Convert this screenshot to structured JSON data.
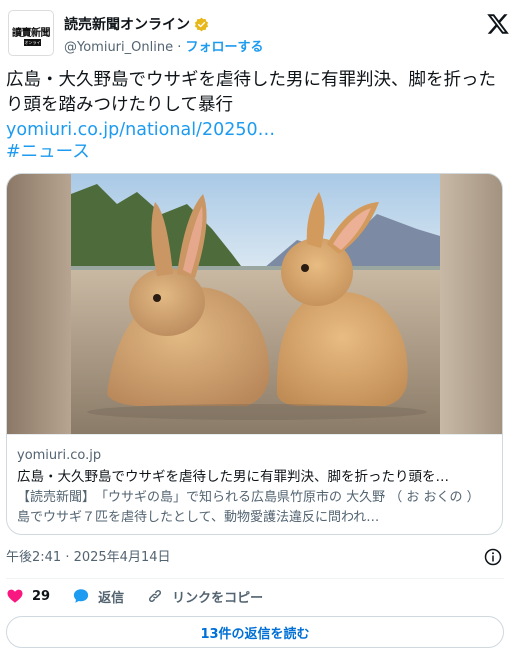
{
  "account": {
    "display_name": "読売新聞オンライン",
    "handle": "@Yomiuri_Online",
    "separator": " · ",
    "follow_label": "フォローする",
    "avatar_text": "讀賣新聞",
    "avatar_subtext": "オンライン",
    "verified_color": "#e8b81a"
  },
  "tweet": {
    "text": "広島・大久野島でウサギを虐待した男に有罪判決、脚を折ったり頭を踏みつけたりして暴行",
    "link": "yomiuri.co.jp/national/20250…",
    "hashtag": "#ニュース"
  },
  "card": {
    "image_icon": "rabbits-photo",
    "domain": "yomiuri.co.jp",
    "title": "広島・大久野島でウサギを虐待した男に有罪判決、脚を折ったり頭を…",
    "description": "【読売新聞】　「ウサギの島」で知られる広島県竹原市の 大久野 （ お おくの ） 島でウサギ７匹を虐待したとして、動物愛護法違反に問われ…"
  },
  "meta": {
    "timestamp": "午後2:41 · 2025年4月14日"
  },
  "actions": {
    "like_count": "29",
    "reply_label": "返信",
    "copy_link_label": "リンクをコピー"
  },
  "replies_button_label": "13件の返信を読む",
  "colors": {
    "accent": "#1d9bf0",
    "like": "#f91880",
    "text": "#0f1419",
    "muted": "#536471"
  }
}
